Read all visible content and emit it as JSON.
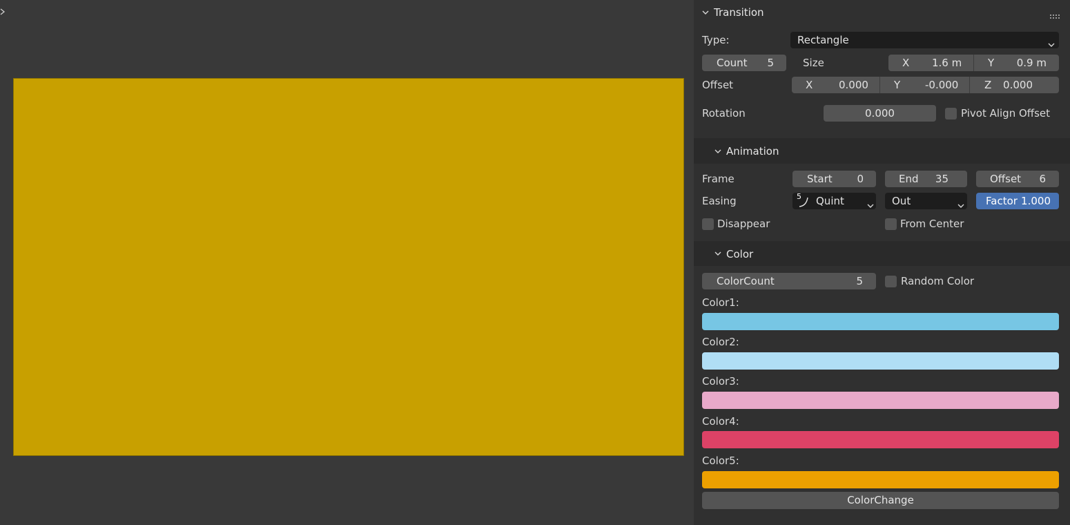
{
  "viewport": {
    "canvas_color": "#c8a000"
  },
  "transition": {
    "title": "Transition",
    "type_label": "Type:",
    "type_value": "Rectangle",
    "count_label": "Count",
    "count_value": "5",
    "size_label": "Size",
    "size_x_label": "X",
    "size_x_value": "1.6 m",
    "size_y_label": "Y",
    "size_y_value": "0.9 m",
    "offset_label": "Offset",
    "offset_x_label": "X",
    "offset_x_value": "0.000",
    "offset_y_label": "Y",
    "offset_y_value": "-0.000",
    "offset_z_label": "Z",
    "offset_z_value": "0.000",
    "rotation_label": "Rotation",
    "rotation_value": "0.000",
    "pivot_align_label": "Pivot Align Offset"
  },
  "animation": {
    "title": "Animation",
    "frame_label": "Frame",
    "start_label": "Start",
    "start_value": "0",
    "end_label": "End",
    "end_value": "35",
    "offset_label": "Offset",
    "offset_value": "6",
    "easing_label": "Easing",
    "easing_icon_num": "5",
    "easing_value": "Quint",
    "easing_dir_value": "Out",
    "factor_label": "Factor",
    "factor_value": "1.000",
    "disappear_label": "Disappear",
    "from_center_label": "From Center"
  },
  "color": {
    "title": "Color",
    "colorcount_label": "ColorCount",
    "colorcount_value": "5",
    "random_label": "Random Color",
    "colors": [
      {
        "label": "Color1:",
        "hex": "#77c6e4"
      },
      {
        "label": "Color2:",
        "hex": "#b0def5"
      },
      {
        "label": "Color3:",
        "hex": "#e8a9c9"
      },
      {
        "label": "Color4:",
        "hex": "#dd4266"
      },
      {
        "label": "Color5:",
        "hex": "#eca000"
      }
    ],
    "change_button": "ColorChange"
  }
}
